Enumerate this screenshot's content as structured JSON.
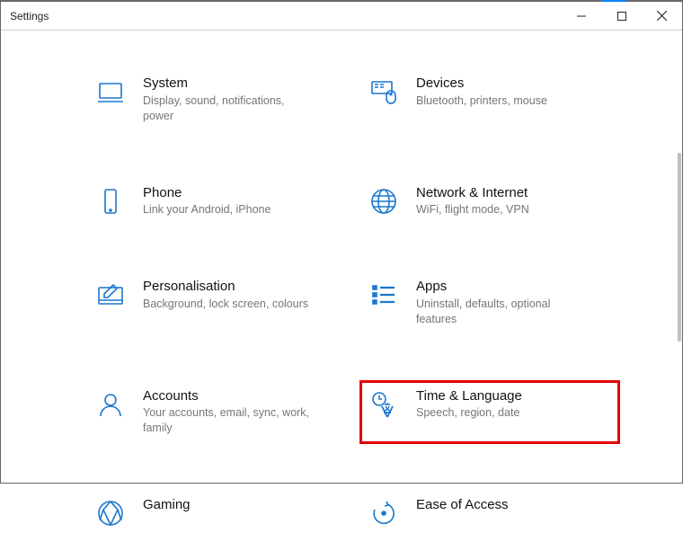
{
  "window": {
    "title": "Settings"
  },
  "items": [
    {
      "id": "system",
      "title": "System",
      "desc": "Display, sound, notifications, power"
    },
    {
      "id": "devices",
      "title": "Devices",
      "desc": "Bluetooth, printers, mouse"
    },
    {
      "id": "phone",
      "title": "Phone",
      "desc": "Link your Android, iPhone"
    },
    {
      "id": "network",
      "title": "Network & Internet",
      "desc": "WiFi, flight mode, VPN"
    },
    {
      "id": "personalisation",
      "title": "Personalisation",
      "desc": "Background, lock screen, colours"
    },
    {
      "id": "apps",
      "title": "Apps",
      "desc": "Uninstall, defaults, optional features"
    },
    {
      "id": "accounts",
      "title": "Accounts",
      "desc": "Your accounts, email, sync, work, family"
    },
    {
      "id": "time-language",
      "title": "Time & Language",
      "desc": "Speech, region, date"
    },
    {
      "id": "gaming",
      "title": "Gaming",
      "desc": ""
    },
    {
      "id": "ease-of-access",
      "title": "Ease of Access",
      "desc": ""
    }
  ],
  "highlighted": "time-language"
}
